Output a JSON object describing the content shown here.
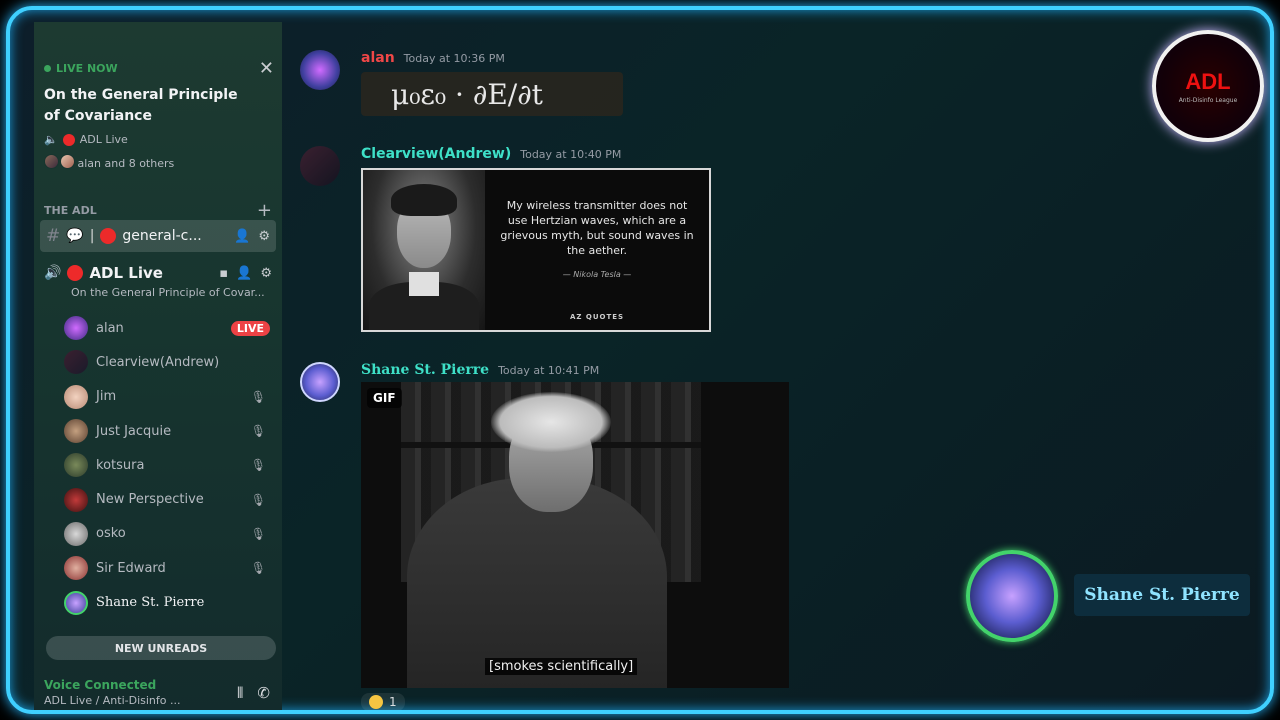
{
  "live": {
    "status": "LIVE NOW",
    "title": "On the General Principle of Covariance",
    "source": "ADL Live",
    "participants": "alan and 8 others",
    "close_icon": "close-icon"
  },
  "server": {
    "category": "THE ADL",
    "text_channel": "general-c...",
    "voice_channel": "ADL Live",
    "voice_topic": "On the General Principle of Covar..."
  },
  "members": [
    {
      "name": "alan",
      "badge": "LIVE"
    },
    {
      "name": "Clearview(Andrew)"
    },
    {
      "name": "Jim"
    },
    {
      "name": "Just Jacquie"
    },
    {
      "name": "kotsura"
    },
    {
      "name": "New Perspective"
    },
    {
      "name": "osko"
    },
    {
      "name": "Sir Edward"
    },
    {
      "name": "Shane St. Pierre"
    }
  ],
  "unreads": "NEW UNREADS",
  "voice": {
    "status": "Voice Connected",
    "location": "ADL Live / Anti-Disinfo ..."
  },
  "messages": [
    {
      "author": "alan",
      "time": "Today at 10:36 PM",
      "equation": "μ₀ε₀ · ∂E/∂t",
      "color": "#f04747"
    },
    {
      "author": "Clearview(Andrew)",
      "time": "Today at 10:40 PM",
      "color": "#3ee0c7",
      "quote": "My wireless transmitter does not use Hertzian waves, which are a grievous myth, but sound waves in the aether.",
      "signature": "— Nikola Tesla —",
      "brand": "AZ QUOTES"
    },
    {
      "author": "Shane St. Pierre",
      "time": "Today at 10:41 PM",
      "color": "#3ee0c7",
      "gif_badge": "GIF",
      "caption": "[smokes scientifically]",
      "reaction_count": "1"
    }
  ],
  "overlay": {
    "logo_text": "ADL",
    "logo_tag": "Anti-Disinfo League",
    "speaker_name": "Shane St. Pierre"
  }
}
